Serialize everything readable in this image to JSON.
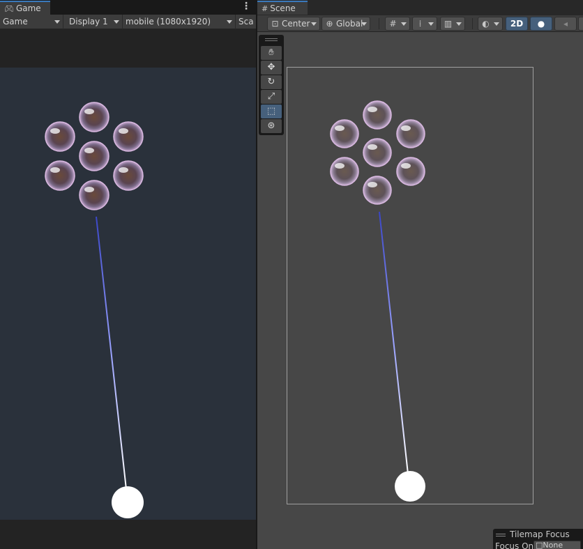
{
  "game": {
    "tab_label": "Game",
    "tab_icon": "gamepad-icon",
    "toolbar": {
      "mode": "Game",
      "display": "Display 1",
      "resolution": "mobile (1080x1920)",
      "scale_label": "Sca"
    }
  },
  "scene": {
    "tab_label": "Scene",
    "tab_icon": "grid-icon",
    "toolbar": {
      "pivot": "Center",
      "space": "Global",
      "mode_2d": "2D"
    },
    "tools": [
      "hand-tool",
      "move-tool",
      "rotate-tool",
      "scale-tool",
      "rect-tool",
      "transform-tool"
    ],
    "active_tool": "rect-tool"
  },
  "tilemap_focus": {
    "title": "Tilemap Focus",
    "label": "Focus On",
    "value": "None"
  },
  "colors": {
    "tab_accent": "#3a79bb",
    "active_button": "#46607c",
    "game_background": "#2a313b",
    "scene_background": "#474747",
    "bubble_tint": "#b48cb4",
    "aim_line": "#4a5ad8",
    "shooter": "#ffffff"
  }
}
